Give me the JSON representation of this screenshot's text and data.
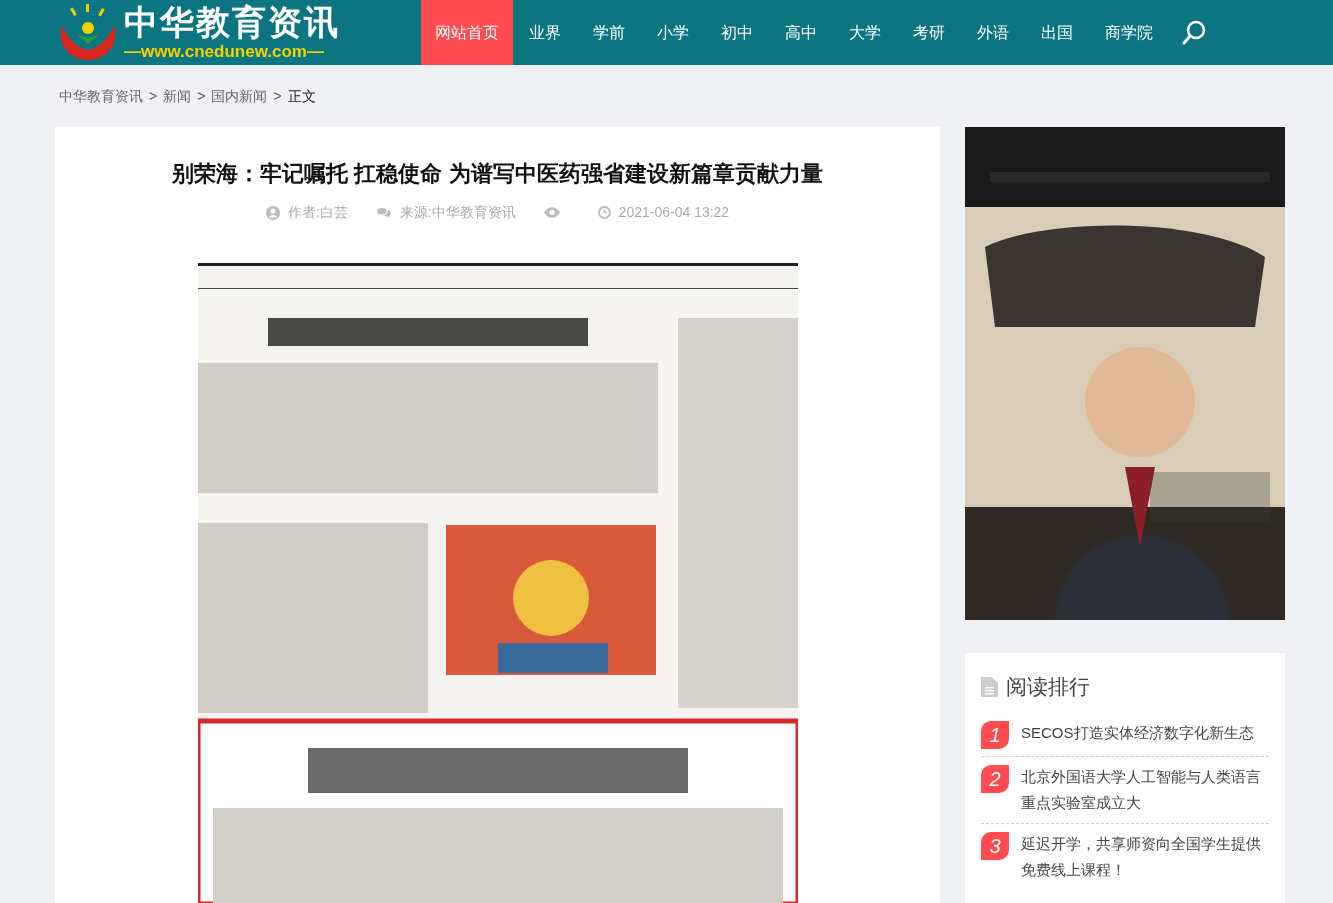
{
  "header": {
    "logo": {
      "title": "中华教育资讯",
      "url": "—www.cnedunew.com—"
    },
    "nav": [
      {
        "label": "网站首页",
        "selected": true
      },
      {
        "label": "业界",
        "selected": false
      },
      {
        "label": "学前",
        "selected": false
      },
      {
        "label": "小学",
        "selected": false
      },
      {
        "label": "初中",
        "selected": false
      },
      {
        "label": "高中",
        "selected": false
      },
      {
        "label": "大学",
        "selected": false
      },
      {
        "label": "考研",
        "selected": false
      },
      {
        "label": "外语",
        "selected": false
      },
      {
        "label": "出国",
        "selected": false
      },
      {
        "label": "商学院",
        "selected": false
      }
    ]
  },
  "breadcrumb": [
    {
      "label": "中华教育资讯"
    },
    {
      "separator": ">",
      "label": "新闻"
    },
    {
      "separator": ">",
      "label": "国内新闻"
    },
    {
      "separator": ">",
      "label": "正文"
    }
  ],
  "article": {
    "title": "别荣海：牢记嘱托 扛稳使命 为谱写中医药强省建设新篇章贡献力量",
    "author": "作者:白芸",
    "source": "来源:中华教育资讯",
    "date": "2021-06-04 13:22"
  },
  "sidebar": {
    "ranking": {
      "title": "阅读排行",
      "items": [
        {
          "rank": "1",
          "title": "SECOS打造实体经济数字化新生态"
        },
        {
          "rank": "2",
          "title": "北京外国语大学人工智能与人类语言重点实验室成立大"
        },
        {
          "rank": "3",
          "title": "延迟开学，共享师资向全国学生提供免费线上课程！"
        }
      ]
    }
  }
}
